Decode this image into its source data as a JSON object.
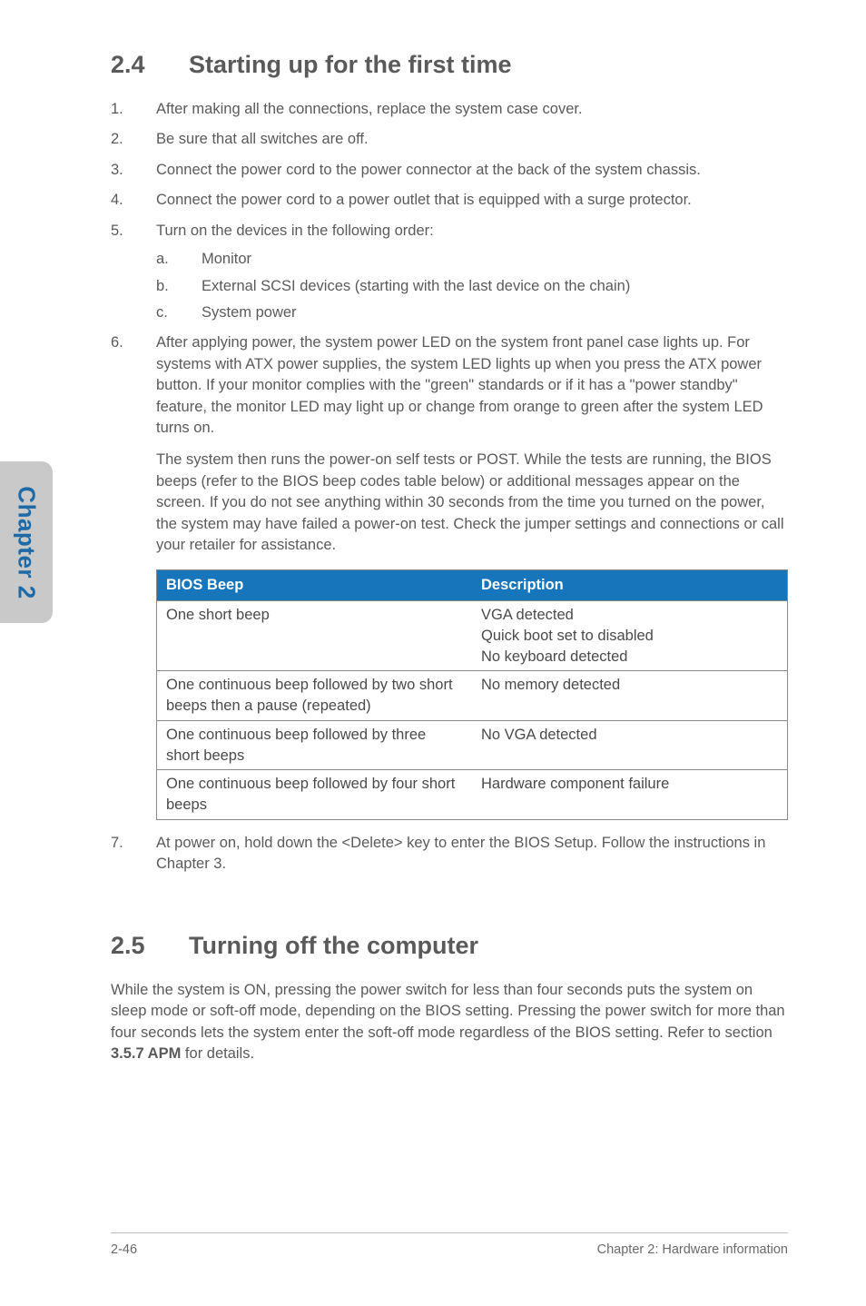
{
  "sideTab": "Chapter 2",
  "section24": {
    "number": "2.4",
    "title": "Starting up for the first time",
    "steps": [
      "After making all the connections, replace the system case cover.",
      "Be sure that all switches are off.",
      "Connect the power cord to the power connector at the back of the system chassis.",
      "Connect the power cord to a power outlet that is equipped with a surge protector.",
      "Turn on the devices in the following order:"
    ],
    "substeps": [
      "Monitor",
      "External SCSI devices (starting with the last device on the chain)",
      "System power"
    ],
    "step6": "After applying power, the system power LED on the system front panel case lights up. For systems with ATX power supplies, the system LED lights up when you press the ATX power button. If your monitor complies with the \"green\" standards or if it has a \"power standby\" feature, the monitor LED may light up or change from orange to green after the system LED turns on.",
    "step6b": "The system then runs the power-on self tests or POST. While the tests are running, the BIOS beeps (refer to the BIOS beep codes table below) or additional messages appear on the screen. If you do not see anything within 30 seconds from the time you turned on the power, the system may have failed a power-on test. Check the jumper settings and connections or call your retailer for assistance.",
    "table": {
      "headers": [
        "BIOS Beep",
        "Description"
      ],
      "rows": [
        [
          "One short beep",
          "VGA detected\nQuick boot set to disabled\nNo keyboard detected"
        ],
        [
          "One continuous beep followed by two short beeps then a pause (repeated)",
          "No memory detected"
        ],
        [
          "One continuous beep followed by three short beeps",
          "No VGA detected"
        ],
        [
          "One continuous beep followed by four short beeps",
          "Hardware component failure"
        ]
      ]
    },
    "step7": "At power on, hold down the <Delete> key to enter the BIOS Setup. Follow the instructions in Chapter 3."
  },
  "section25": {
    "number": "2.5",
    "title": "Turning off the computer",
    "body": "While the system is ON, pressing the power switch for less than four seconds puts the system on sleep mode or soft-off mode, depending on the BIOS setting. Pressing the power switch for more than four seconds lets the system enter the soft-off mode regardless of the BIOS setting. Refer to section 3.5.7 APM for details."
  },
  "footer": {
    "left": "2-46",
    "right": "Chapter 2: Hardware information"
  }
}
